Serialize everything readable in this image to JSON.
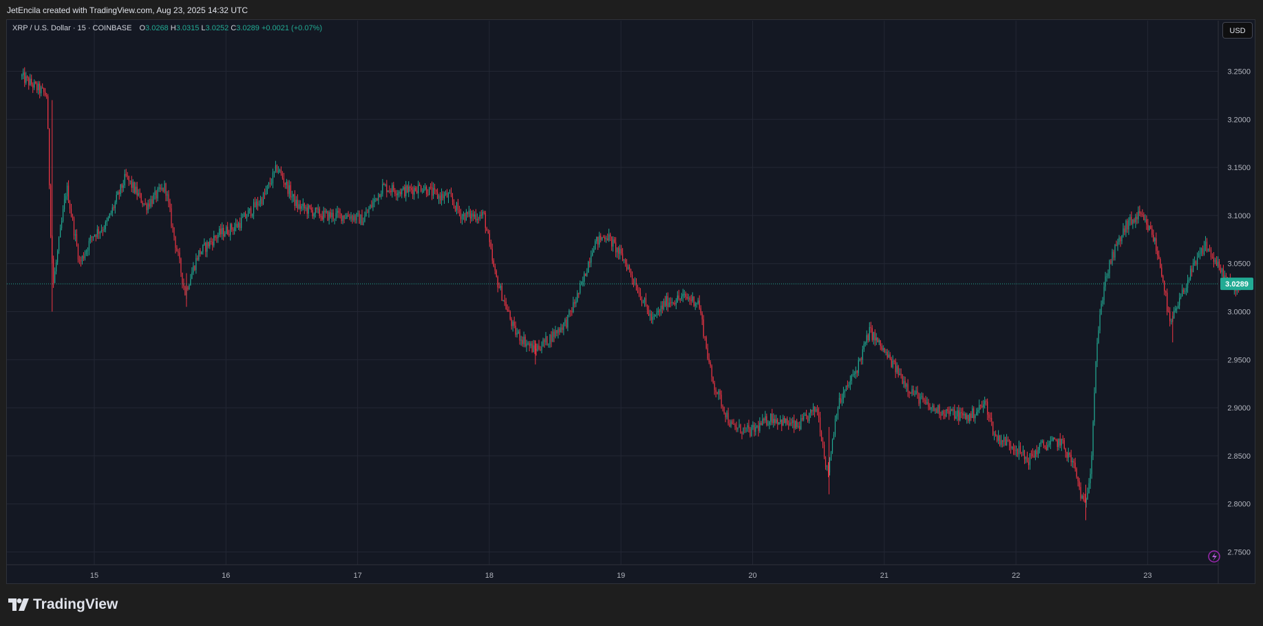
{
  "header": {
    "attribution": "JetEncila created with TradingView.com, Aug 23, 2025 14:32 UTC"
  },
  "legend": {
    "symbol": "XRP / U.S. Dollar · 15 · COINBASE",
    "o_label": "O",
    "o_value": "3.0268",
    "h_label": "H",
    "h_value": "3.0315",
    "l_label": "L",
    "l_value": "3.0252",
    "c_label": "C",
    "c_value": "3.0289",
    "change": "+0.0021 (+0.07%)"
  },
  "currency_button": "USD",
  "last_price": "3.0289",
  "footer": {
    "brand": "TradingView"
  },
  "colors": {
    "up": "#22ab94",
    "down": "#f23645",
    "background": "#141823",
    "grid": "#232734",
    "text": "#b2b5be"
  },
  "chart_data": {
    "type": "candlestick",
    "symbol": "XRP/USD",
    "interval": "15",
    "y_ticks": [
      "3.2500",
      "3.2000",
      "3.1500",
      "3.1000",
      "3.0500",
      "3.0000",
      "2.9500",
      "2.9000",
      "2.8500",
      "2.8000",
      "2.7500"
    ],
    "x_ticks": [
      "15",
      "16",
      "17",
      "18",
      "19",
      "20",
      "21",
      "22",
      "23"
    ],
    "ylim": [
      2.735,
      3.29
    ],
    "x_range_days": [
      14.45,
      23.72
    ],
    "last_price": 3.0289,
    "price_path": [
      [
        14.45,
        3.245
      ],
      [
        14.65,
        3.225
      ],
      [
        14.68,
        3.08
      ],
      [
        14.7,
        3.03
      ],
      [
        14.8,
        3.13
      ],
      [
        14.9,
        3.05
      ],
      [
        15.0,
        3.08
      ],
      [
        15.1,
        3.09
      ],
      [
        15.25,
        3.14
      ],
      [
        15.4,
        3.11
      ],
      [
        15.55,
        3.13
      ],
      [
        15.6,
        3.09
      ],
      [
        15.7,
        3.02
      ],
      [
        15.8,
        3.06
      ],
      [
        15.95,
        3.08
      ],
      [
        16.1,
        3.09
      ],
      [
        16.3,
        3.12
      ],
      [
        16.4,
        3.15
      ],
      [
        16.55,
        3.11
      ],
      [
        16.75,
        3.1
      ],
      [
        16.95,
        3.1
      ],
      [
        17.05,
        3.095
      ],
      [
        17.2,
        3.13
      ],
      [
        17.35,
        3.125
      ],
      [
        17.5,
        3.13
      ],
      [
        17.62,
        3.12
      ],
      [
        17.7,
        3.12
      ],
      [
        17.8,
        3.1
      ],
      [
        17.97,
        3.1
      ],
      [
        18.05,
        3.04
      ],
      [
        18.2,
        2.98
      ],
      [
        18.35,
        2.96
      ],
      [
        18.45,
        2.97
      ],
      [
        18.6,
        2.99
      ],
      [
        18.72,
        3.03
      ],
      [
        18.8,
        3.07
      ],
      [
        18.9,
        3.08
      ],
      [
        19.05,
        3.05
      ],
      [
        19.15,
        3.02
      ],
      [
        19.25,
        2.99
      ],
      [
        19.35,
        3.01
      ],
      [
        19.5,
        3.015
      ],
      [
        19.6,
        3.01
      ],
      [
        19.7,
        2.93
      ],
      [
        19.85,
        2.88
      ],
      [
        20.0,
        2.875
      ],
      [
        20.15,
        2.89
      ],
      [
        20.35,
        2.88
      ],
      [
        20.5,
        2.9
      ],
      [
        20.58,
        2.83
      ],
      [
        20.65,
        2.9
      ],
      [
        20.8,
        2.94
      ],
      [
        20.9,
        2.98
      ],
      [
        21.05,
        2.95
      ],
      [
        21.2,
        2.92
      ],
      [
        21.35,
        2.9
      ],
      [
        21.5,
        2.895
      ],
      [
        21.65,
        2.89
      ],
      [
        21.78,
        2.905
      ],
      [
        21.85,
        2.87
      ],
      [
        22.0,
        2.86
      ],
      [
        22.1,
        2.845
      ],
      [
        22.2,
        2.86
      ],
      [
        22.35,
        2.865
      ],
      [
        22.45,
        2.84
      ],
      [
        22.53,
        2.795
      ],
      [
        22.58,
        2.84
      ],
      [
        22.62,
        2.96
      ],
      [
        22.68,
        3.03
      ],
      [
        22.75,
        3.06
      ],
      [
        22.85,
        3.09
      ],
      [
        22.95,
        3.1
      ],
      [
        23.05,
        3.08
      ],
      [
        23.12,
        3.04
      ],
      [
        23.18,
        2.985
      ],
      [
        23.25,
        3.01
      ],
      [
        23.32,
        3.035
      ],
      [
        23.45,
        3.07
      ],
      [
        23.55,
        3.045
      ],
      [
        23.65,
        3.025
      ],
      [
        23.71,
        3.0289
      ]
    ]
  }
}
